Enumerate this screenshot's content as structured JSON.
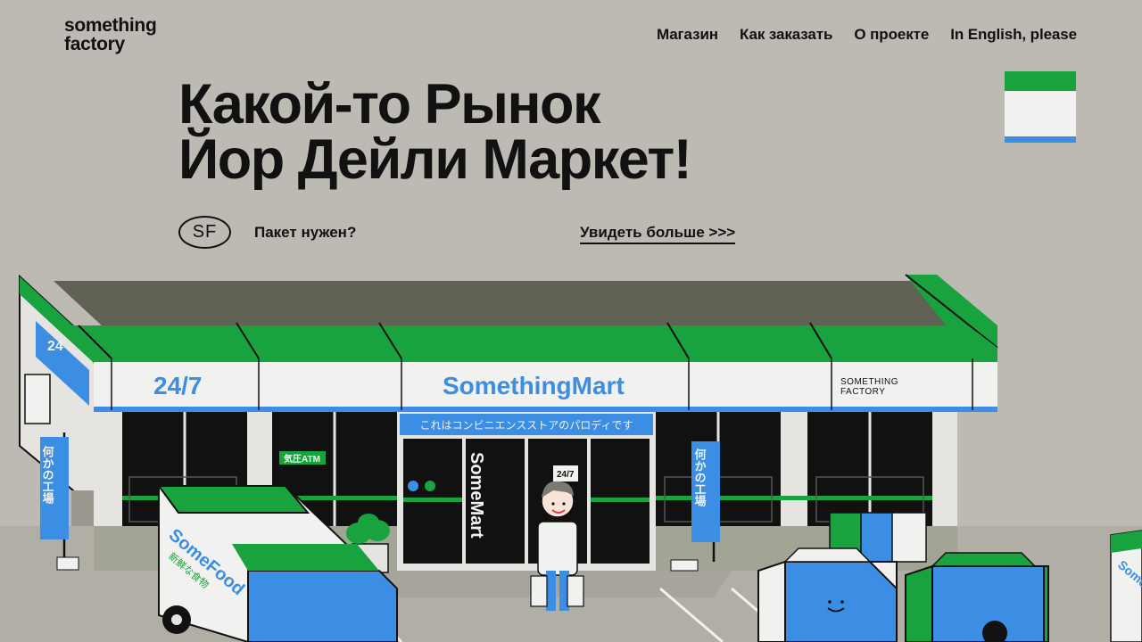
{
  "logo": {
    "line1": "something",
    "line2": "factory"
  },
  "nav": [
    {
      "label": "Магазин"
    },
    {
      "label": "Как заказать"
    },
    {
      "label": "О проекте"
    },
    {
      "label": "In English, please"
    }
  ],
  "hero": {
    "line1": "Какой-то Рынок",
    "line2": "Йор Дейли Маркет!",
    "badge": "SF",
    "bag_question": "Пакет нужен?",
    "see_more": "Увидеть больше >>>"
  },
  "store": {
    "sign_247": "24/7",
    "name": "SomethingMart",
    "brand_line1": "SOMETHING",
    "brand_line2": "FACTORY",
    "banner": "これはコンビニエンスストアのパロディです",
    "atm": "気圧ATM",
    "door_text": "SomeMart",
    "door_sticker": "24/7",
    "side_24": "24",
    "flag_text": "何かの工場",
    "truck_name": "SomeFood",
    "truck_sub": "新鮮な食物",
    "right_sign": "Some Mart"
  },
  "colors": {
    "background": "#BDBAB3",
    "green": "#18A33F",
    "blue": "#3B8EE3",
    "white": "#F1F1EF",
    "dark": "#111111"
  }
}
